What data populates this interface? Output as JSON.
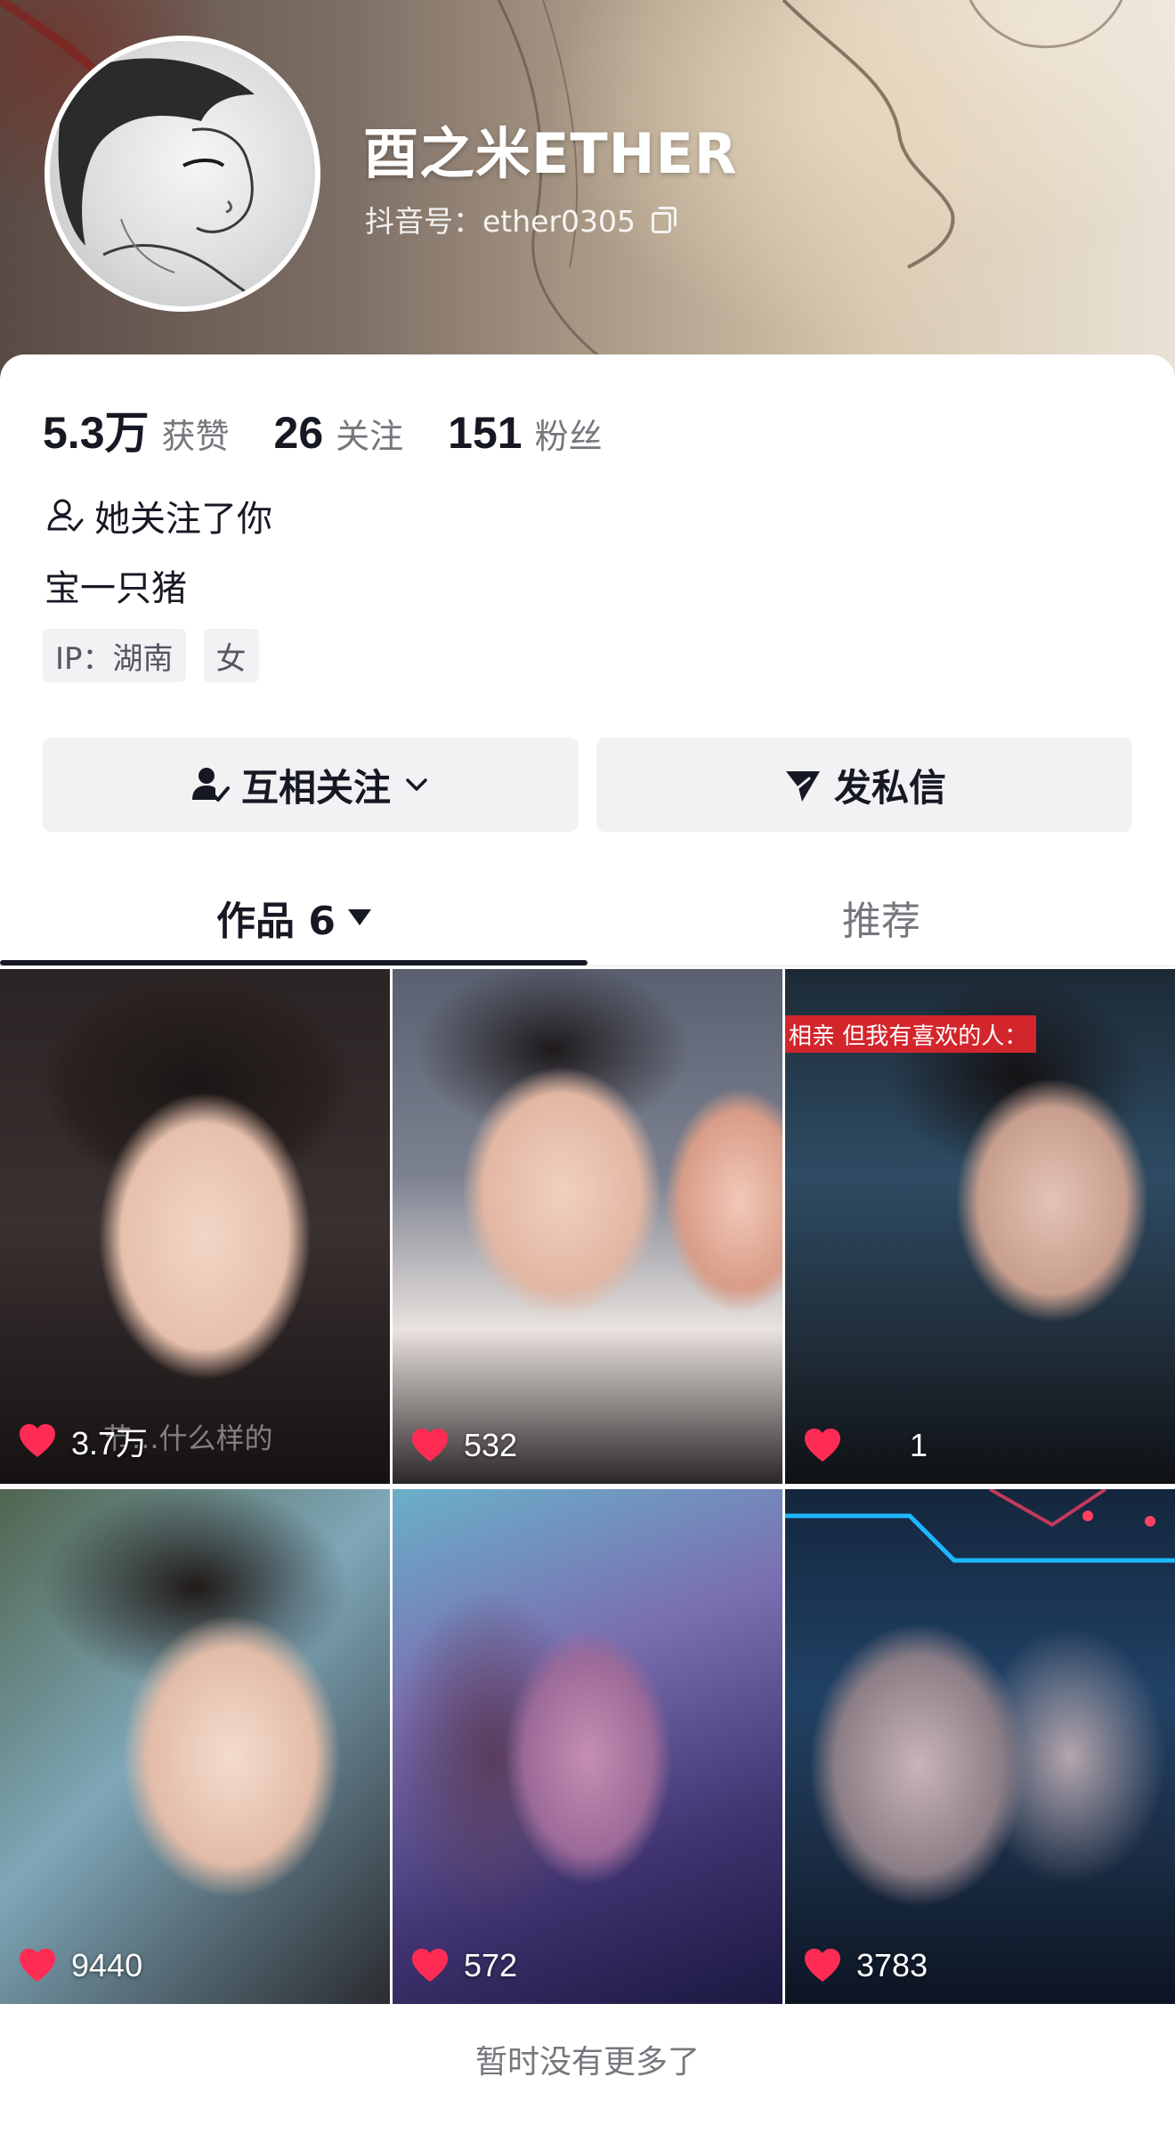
{
  "profile": {
    "nickname": "酉之米ETHER",
    "douyin_id": "抖音号：ether0305",
    "follows_you": "她关注了你",
    "bio": "宝一只猪",
    "tags": [
      "IP：湖南",
      "女"
    ]
  },
  "stats": {
    "likes": {
      "value": "5.3万",
      "label": "获赞"
    },
    "following": {
      "value": "26",
      "label": "关注"
    },
    "followers": {
      "value": "151",
      "label": "粉丝"
    }
  },
  "actions": {
    "mutual_follow": "互相关注",
    "message": "发私信"
  },
  "tabs": {
    "works": "作品 6",
    "recommended": "推荐"
  },
  "videos": [
    {
      "likes": "3.7万",
      "overlay_text": "节...什么样的"
    },
    {
      "likes": "532"
    },
    {
      "likes": "1",
      "caption": "相亲 但我有喜欢的人："
    },
    {
      "likes": "9440"
    },
    {
      "likes": "572"
    },
    {
      "likes": "3783"
    }
  ],
  "footer": "暂时没有更多了",
  "colors": {
    "text_primary": "#161823",
    "text_secondary": "#75777d",
    "button_bg": "#f2f2f4",
    "like_heart": "#fe2c55"
  },
  "icons": [
    "copy-icon",
    "person-icon",
    "person-check-icon",
    "chevron-down-icon",
    "send-icon",
    "heart-icon",
    "caret-down-icon"
  ]
}
